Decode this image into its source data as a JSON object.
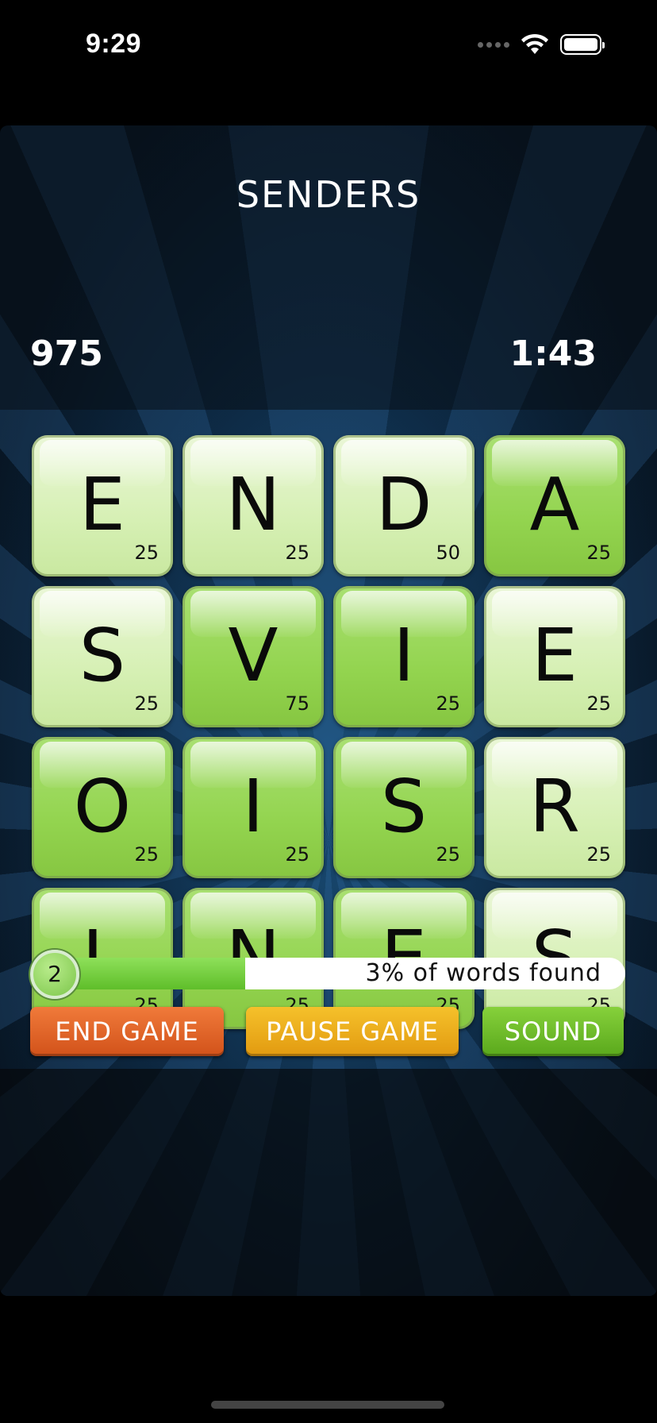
{
  "status_bar": {
    "time": "9:29",
    "icons": [
      "cellular-dots-icon",
      "wifi-icon",
      "battery-icon"
    ]
  },
  "game": {
    "current_word": "SENDERS",
    "score": "975",
    "timer": "1:43",
    "board": [
      [
        {
          "letter": "E",
          "points": "25",
          "style": "light"
        },
        {
          "letter": "N",
          "points": "25",
          "style": "light"
        },
        {
          "letter": "D",
          "points": "50",
          "style": "light"
        },
        {
          "letter": "A",
          "points": "25",
          "style": "green"
        }
      ],
      [
        {
          "letter": "S",
          "points": "25",
          "style": "light"
        },
        {
          "letter": "V",
          "points": "75",
          "style": "green"
        },
        {
          "letter": "I",
          "points": "25",
          "style": "green"
        },
        {
          "letter": "E",
          "points": "25",
          "style": "light"
        }
      ],
      [
        {
          "letter": "O",
          "points": "25",
          "style": "green"
        },
        {
          "letter": "I",
          "points": "25",
          "style": "green"
        },
        {
          "letter": "S",
          "points": "25",
          "style": "green"
        },
        {
          "letter": "R",
          "points": "25",
          "style": "light"
        }
      ],
      [
        {
          "letter": "L",
          "points": "25",
          "style": "green"
        },
        {
          "letter": "N",
          "points": "25",
          "style": "green"
        },
        {
          "letter": "E",
          "points": "25",
          "style": "green"
        },
        {
          "letter": "S",
          "points": "25",
          "style": "light"
        }
      ]
    ],
    "level": "2",
    "progress_label": "3% of words found",
    "progress_fraction": 0.36,
    "buttons": {
      "end": "END GAME",
      "pause": "PAUSE GAME",
      "sound": "SOUND"
    }
  },
  "colors": {
    "tile_light": "#d6f0b4",
    "tile_green": "#93d44f",
    "end_button": "#d2521a",
    "pause_button": "#e29a10",
    "sound_button": "#5aa81c"
  }
}
